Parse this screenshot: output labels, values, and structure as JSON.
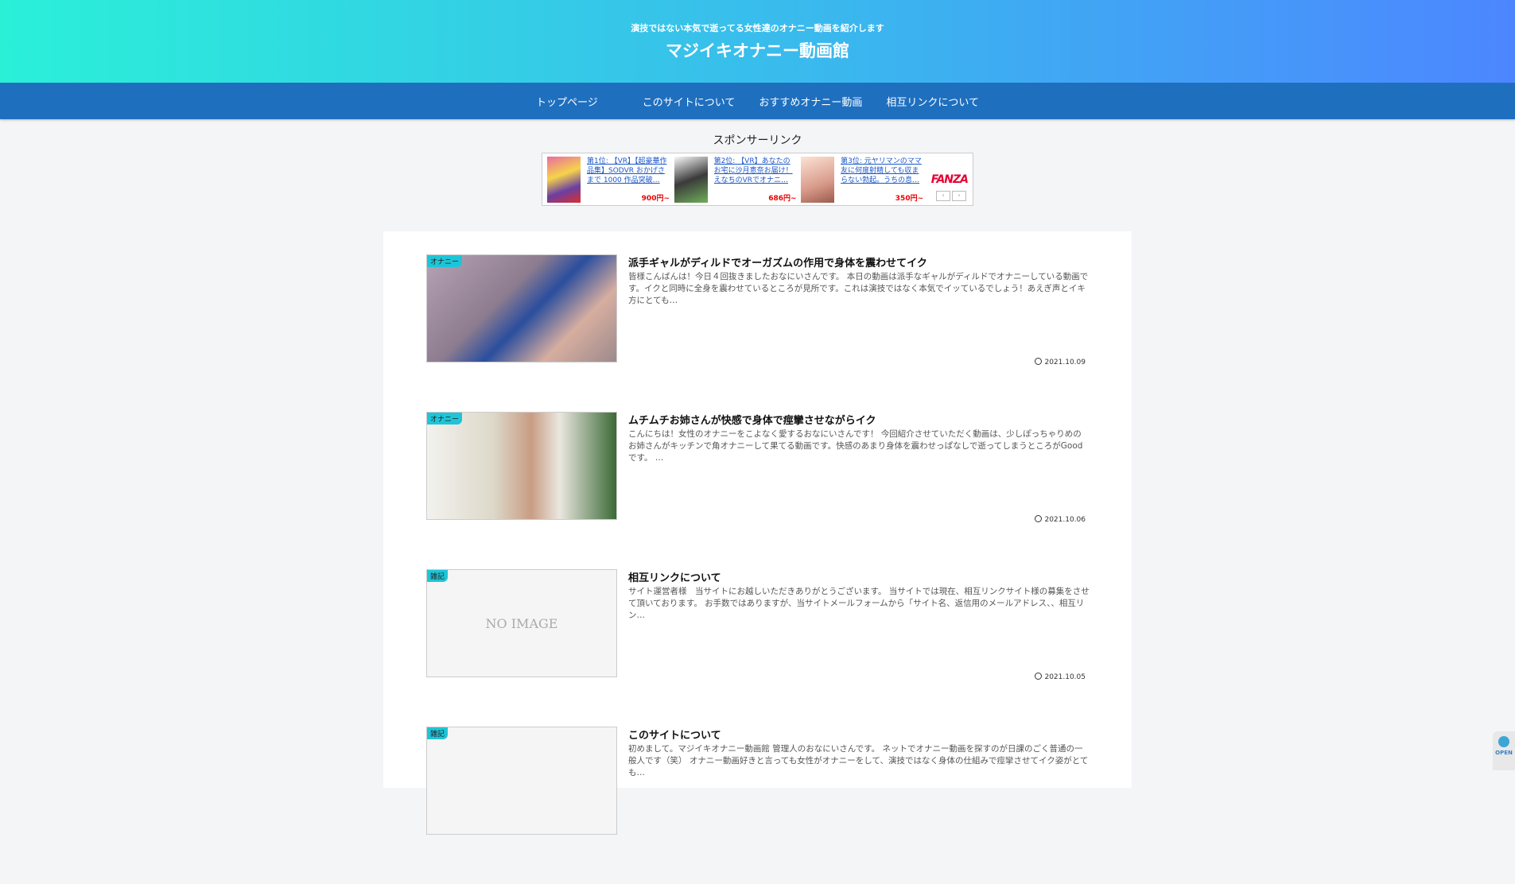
{
  "header": {
    "tagline": "演技ではない本気で逝ってる女性達のオナニー動画を紹介します",
    "title": "マジイキオナニー動画館"
  },
  "nav": [
    {
      "label": "トップページ"
    },
    {
      "label": "このサイトについて"
    },
    {
      "label": "おすすめオナニー動画"
    },
    {
      "label": "相互リンクについて"
    }
  ],
  "sponsor": {
    "heading": "スポンサーリンク",
    "ads": [
      {
        "label": "第1位: 【VR】【超豪華作品集】SODVR おかげさまで 1000 作品突破…",
        "price": "900円~"
      },
      {
        "label": "第2位: 【VR】あなたのお宅に沙月恵奈お届け！えなちのVRでオナニ…",
        "price": "686円~"
      },
      {
        "label": "第3位: 元ヤリマンのママ友に何度射精しても収まらない勃起。うちの息…",
        "price": "350円~"
      }
    ],
    "brand": "FANZA",
    "prev_icon": "chevron-left-icon",
    "next_icon": "chevron-right-icon"
  },
  "posts": [
    {
      "category": "オナニー",
      "title": "派手ギャルがディルドでオーガズムの作用で身体を震わせてイク",
      "excerpt": "皆様こんばんは！今日４回抜きましたおなにいさんです。 本日の動画は派手なギャルがディルドでオナニーしている動画です。イクと同時に全身を震わせているところが見所です。これは演技ではなく本気でイッているでしょう！あえぎ声とイキ方にとても…",
      "date": "2021.10.09"
    },
    {
      "category": "オナニー",
      "title": "ムチムチお姉さんが快感で身体で痙攣させながらイク",
      "excerpt": "こんにちは！女性のオナニーをこよなく愛するおなにいさんです！ 今回紹介させていただく動画は、少しぽっちゃりめのお姉さんがキッチンで角オナニーして果てる動画です。快感のあまり身体を震わせっぱなしで逝ってしまうところがGoodです。 …",
      "date": "2021.10.06"
    },
    {
      "category": "雑記",
      "noimage": "NO IMAGE",
      "title": "相互リンクについて",
      "excerpt": "サイト運営者様　当サイトにお越しいただきありがとうございます。 当サイトでは現在、相互リンクサイト様の募集をさせて頂いております。 お手数ではありますが、当サイトメールフォームから「サイト名、返信用のメールアドレス、、相互リン…",
      "date": "2021.10.05"
    },
    {
      "category": "雑記",
      "title": "このサイトについて",
      "excerpt": "初めまして。マジイキオナニー動画館 管理人のおなにいさんです。 ネットでオナニー動画を探すのが日課のごく普通の一般人です（笑） オナニー動画好きと言っても女性がオナニーをして、演技ではなく身体の仕組みで痙攣させてイク姿がとても…",
      "date": ""
    }
  ],
  "open_button": {
    "label": "OPEN"
  }
}
